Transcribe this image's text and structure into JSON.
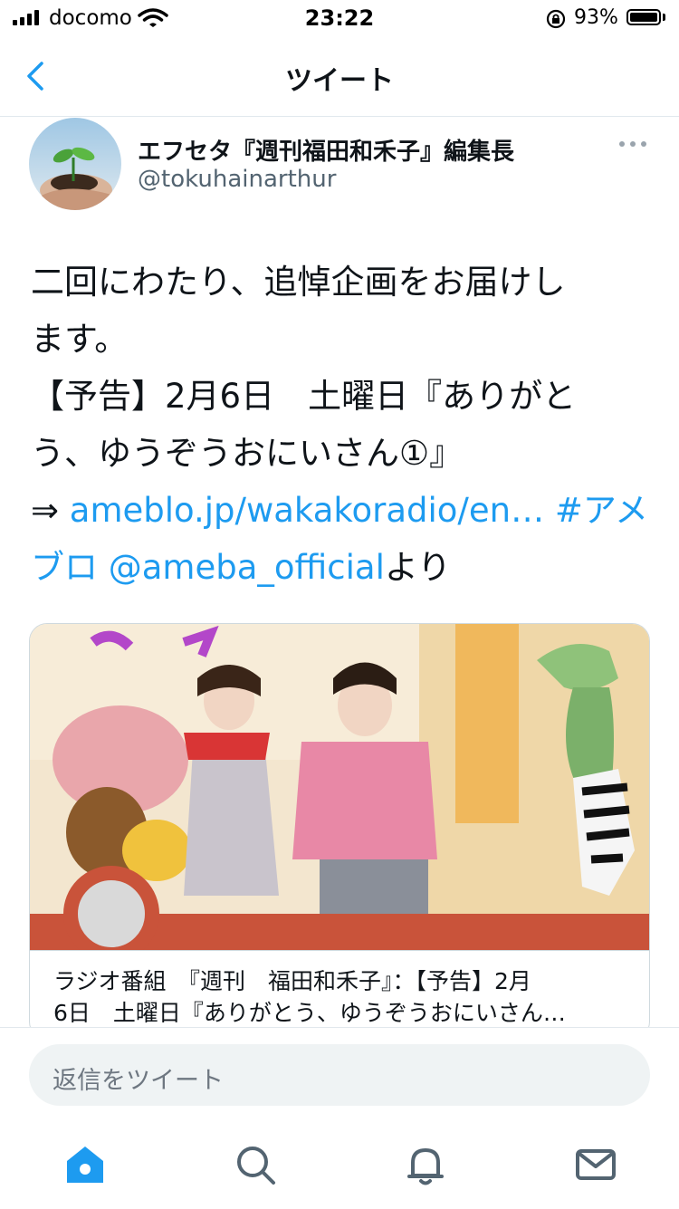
{
  "status_bar": {
    "carrier": "docomo",
    "time": "23:22",
    "battery": "93%"
  },
  "nav": {
    "title": "ツイート",
    "back_icon": "chevron-left-icon"
  },
  "tweet": {
    "author_name": "エフセタ『週刊福田和禾子』編集長",
    "author_handle": "@tokuhainarthur",
    "lines": {
      "l1": "二回にわたり、追悼企画をお届けし",
      "l2": "ます。",
      "l3": "【予告】2月6日　土曜日『ありがと",
      "l4": "う、ゆうぞうおにいさん①』"
    },
    "arrow": "⇒ ",
    "url": "ameblo.jp/wakakoradio/en…",
    "hashtag_part1": " #アメ",
    "hashtag_part2": "ブロ",
    "mention": " @ameba_official",
    "suffix": "より"
  },
  "card": {
    "title_line1": "ラジオ番組　『週刊　福田和禾子』：【予告】2月",
    "title_line2": "6日　土曜日『ありがとう、ゆうぞうおにいさん…"
  },
  "reply": {
    "placeholder": "返信をツイート"
  },
  "tabs": [
    "home-icon",
    "search-icon",
    "notifications-icon",
    "messages-icon"
  ],
  "colors": {
    "accent": "#1d9bf0",
    "text": "#0f1419",
    "secondary": "#536471"
  }
}
